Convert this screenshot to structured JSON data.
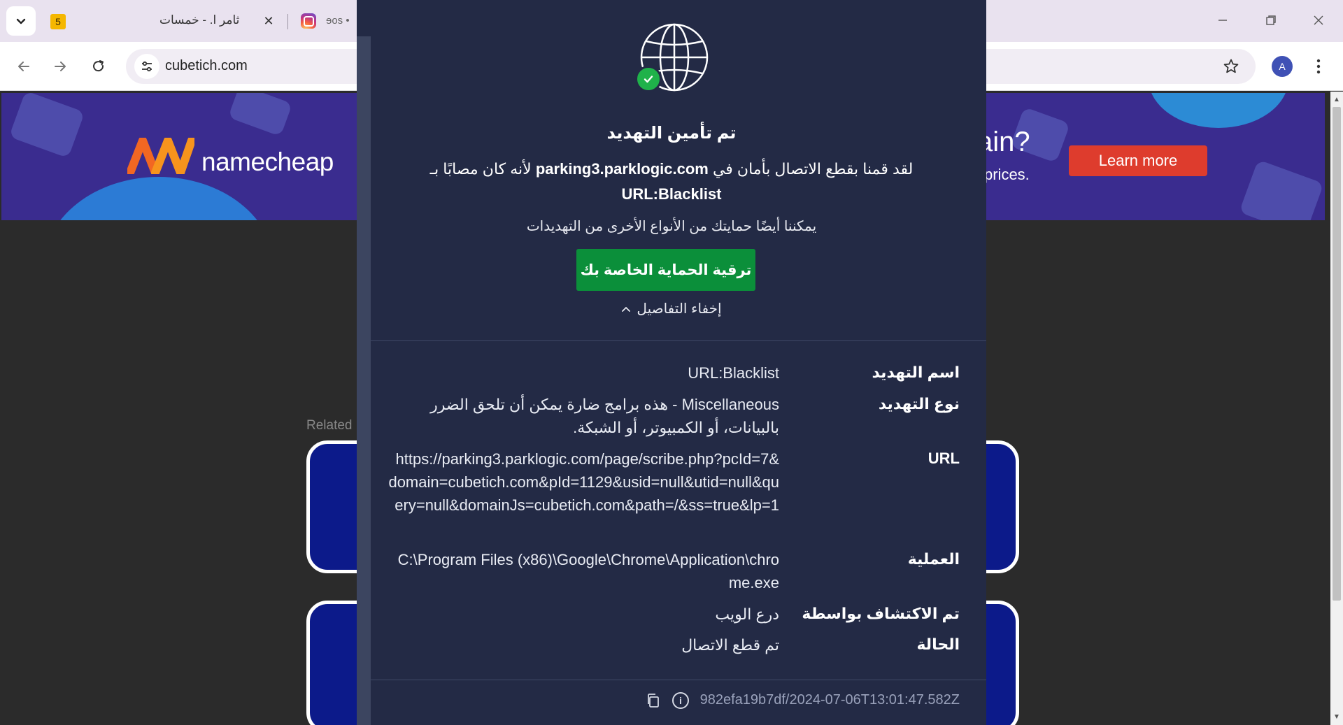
{
  "browser": {
    "tabs": [
      {
        "badge": "5",
        "title": "ثامر ا. - خمسات"
      },
      {
        "title": "ɘos •"
      }
    ],
    "address": "cubetich.com",
    "profile_initial": "A"
  },
  "ad": {
    "brand": "namecheap",
    "headline": "ain?",
    "subline": "prices.",
    "cta": "Learn more",
    "colors": {
      "background": "#3a2c8f",
      "cta": "#de3c2d",
      "logo_orange": "#f26722"
    }
  },
  "page": {
    "related_label": "Related"
  },
  "alert": {
    "title": "تم تأمين التهديد",
    "message_prefix": "لقد قمنا بقطع الاتصال بأمان في",
    "message_host": "parking3.parklogic.com",
    "message_mid": "لأنه كان مصابًا بـ",
    "message_threat": "URL:Blacklist",
    "also_protect": "يمكننا أيضًا حمايتك من الأنواع الأخرى من التهديدات",
    "upgrade_button": "ترقية الحماية الخاصة بك",
    "hide_details": "إخفاء التفاصيل",
    "details": [
      {
        "label": "اسم التهديد",
        "value": "URL:Blacklist"
      },
      {
        "label": "نوع التهديد",
        "value": "Miscellaneous - هذه برامج ضارة يمكن أن تلحق الضرر بالبيانات، أو الكمبيوتر، أو الشبكة."
      },
      {
        "label": "URL",
        "value": "https://parking3.parklogic.com/page/scribe.php?pcId=7&domain=cubetich.com&pId=1129&usid=null&utid=null&query=null&domainJs=cubetich.com&path=/&ss=true&lp=1"
      },
      {
        "label": "العملية",
        "value": "C:\\Program Files (x86)\\Google\\Chrome\\Application\\chrome.exe"
      },
      {
        "label": "تم الاكتشاف بواسطة",
        "value": "درع الويب"
      },
      {
        "label": "الحالة",
        "value": "تم قطع الاتصال"
      }
    ],
    "footer_id": "982efa19b7df/2024-07-06T13:01:47.582Z",
    "colors": {
      "panel": "#232a45",
      "success": "#1fb24a",
      "button": "#0b8f3a"
    }
  }
}
